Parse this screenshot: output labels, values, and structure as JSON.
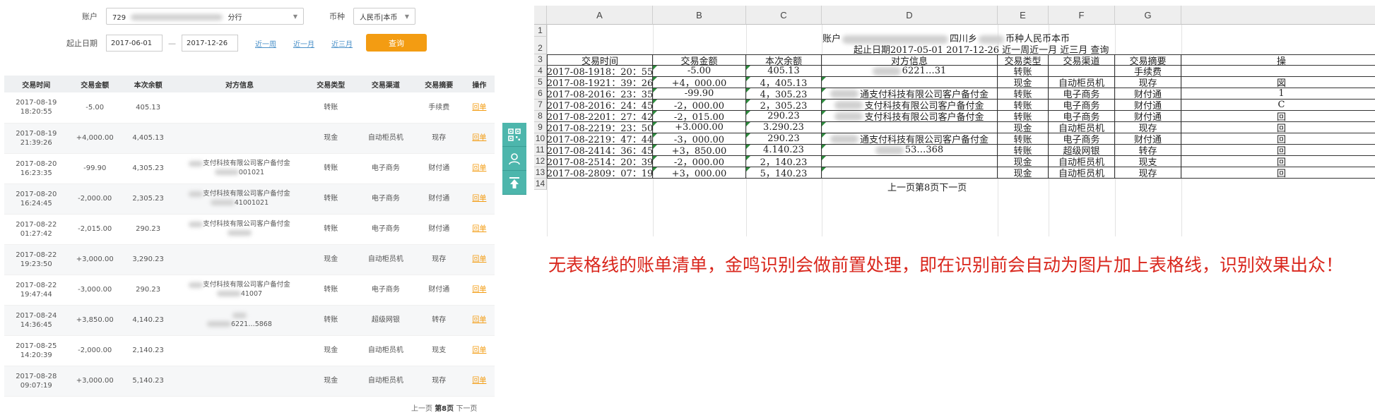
{
  "filters": {
    "account_label": "账户",
    "account_value_prefix": "729",
    "account_value_suffix": "分行",
    "currency_label": "币种",
    "currency_value": "人民币|本币",
    "date_label": "起止日期",
    "date_start": "2017-06-01",
    "date_end": "2017-12-26",
    "quick_links": [
      "近一周",
      "近一月",
      "近三月"
    ],
    "query_button": "查询"
  },
  "table": {
    "headers": [
      "交易时间",
      "交易金额",
      "本次余额",
      "对方信息",
      "交易类型",
      "交易渠道",
      "交易摘要",
      "操作"
    ],
    "rows": [
      {
        "date": "2017-08-19",
        "time": "18:20:55",
        "amount": "-5.00",
        "balance": "405.13",
        "cp1": "",
        "cp2": "",
        "type": "转账",
        "channel": "",
        "summary": "手续费",
        "op": "回单"
      },
      {
        "date": "2017-08-19",
        "time": "21:39:26",
        "amount": "+4,000.00",
        "balance": "4,405.13",
        "cp1": "",
        "cp2": "",
        "type": "现金",
        "channel": "自动柜员机",
        "summary": "现存",
        "op": "回单"
      },
      {
        "date": "2017-08-20",
        "time": "16:23:35",
        "amount": "-99.90",
        "balance": "4,305.23",
        "cp1": "支付科技有限公司客户备付金",
        "cp2": "001021",
        "type": "转账",
        "channel": "电子商务",
        "summary": "财付通",
        "op": "回单"
      },
      {
        "date": "2017-08-20",
        "time": "16:24:45",
        "amount": "-2,000.00",
        "balance": "2,305.23",
        "cp1": "支付科技有限公司客户备付金",
        "cp2": "41001021",
        "type": "转账",
        "channel": "电子商务",
        "summary": "财付通",
        "op": "回单"
      },
      {
        "date": "2017-08-22",
        "time": "01:27:42",
        "amount": "-2,015.00",
        "balance": "290.23",
        "cp1": "支付科技有限公司客户备付金",
        "cp2": "",
        "type": "转账",
        "channel": "电子商务",
        "summary": "财付通",
        "op": "回单"
      },
      {
        "date": "2017-08-22",
        "time": "19:23:50",
        "amount": "+3,000.00",
        "balance": "3,290.23",
        "cp1": "",
        "cp2": "",
        "type": "现金",
        "channel": "自动柜员机",
        "summary": "现存",
        "op": "回单"
      },
      {
        "date": "2017-08-22",
        "time": "19:47:44",
        "amount": "-3,000.00",
        "balance": "290.23",
        "cp1": "支付科技有限公司客户备付金",
        "cp2": "41007",
        "type": "转账",
        "channel": "电子商务",
        "summary": "财付通",
        "op": "回单"
      },
      {
        "date": "2017-08-24",
        "time": "14:36:45",
        "amount": "+3,850.00",
        "balance": "4,140.23",
        "cp1": "",
        "cp2": "6221…5868",
        "type": "转账",
        "channel": "超级网银",
        "summary": "转存",
        "op": "回单"
      },
      {
        "date": "2017-08-25",
        "time": "14:20:39",
        "amount": "-2,000.00",
        "balance": "2,140.23",
        "cp1": "",
        "cp2": "",
        "type": "现金",
        "channel": "自动柜员机",
        "summary": "现支",
        "op": "回单"
      },
      {
        "date": "2017-08-28",
        "time": "09:07:19",
        "amount": "+3,000.00",
        "balance": "5,140.23",
        "cp1": "",
        "cp2": "",
        "type": "现金",
        "channel": "自动柜员机",
        "summary": "现存",
        "op": "回单"
      }
    ]
  },
  "pager": {
    "prev": "上一页",
    "current": "第8页",
    "next": "下一页"
  },
  "tools": [
    {
      "icon": "qrcode-icon"
    },
    {
      "icon": "customer-service-icon"
    },
    {
      "icon": "back-to-top-icon"
    }
  ],
  "sheet": {
    "columns": [
      "A",
      "B",
      "C",
      "D",
      "E",
      "F",
      "G"
    ],
    "row_numbers": [
      "1",
      "2",
      "3",
      "4",
      "5",
      "6",
      "7",
      "8",
      "9",
      "10",
      "11",
      "12",
      "13",
      "14"
    ],
    "title_left": "账户",
    "title_mid": "四川乡",
    "title_right": "币种人民币本币",
    "subtitle": "起止日期2017-05-01 2017-12-26 近一周近一月 近三月 查询",
    "header": [
      "交易时间",
      "交易金额",
      "本次余额",
      "对方信息",
      "交易类型",
      "交易渠道",
      "交易摘要",
      "操"
    ],
    "rows": [
      {
        "time": "2017-08-1918：20：55",
        "amount": "-5.00",
        "balance": "405.13",
        "cp": "6221…31",
        "type": "转账",
        "channel": "",
        "summary": "手续费",
        "op": ""
      },
      {
        "time": "2017-08-1921：39：26",
        "amount": "+4，000.00",
        "balance": "4，405.13",
        "cp": "",
        "type": "现金",
        "channel": "自动柜员机",
        "summary": "现存",
        "op": "図"
      },
      {
        "time": "2017-08-2016：23：35",
        "amount": "-99.90",
        "balance": "4，305.23",
        "cp": "通支付科技有限公司客户备付金",
        "type": "转账",
        "channel": "电子商务",
        "summary": "财付通",
        "op": "1"
      },
      {
        "time": "2017-08-2016：24：45",
        "amount": "-2，000.00",
        "balance": "2，305.23",
        "cp": "支付科技有限公司客户备付金",
        "type": "转账",
        "channel": "电子商务",
        "summary": "财付通",
        "op": "C"
      },
      {
        "time": "2017-08-2201：27：42",
        "amount": "-2，015.00",
        "balance": "290.23",
        "cp": "支付科技有限公司客户备付金",
        "type": "转账",
        "channel": "电子商务",
        "summary": "财付通",
        "op": "回"
      },
      {
        "time": "2017-08-2219：23：50",
        "amount": "+3.000.00",
        "balance": "3.290.23",
        "cp": "",
        "type": "现金",
        "channel": "自动柜员机",
        "summary": "现存",
        "op": "回"
      },
      {
        "time": "2017-08-2219：47：44",
        "amount": "-3，000.00",
        "balance": "290.23",
        "cp": "通支付科技有限公司客户备付金",
        "type": "转账",
        "channel": "电子商务",
        "summary": "财付通",
        "op": "回"
      },
      {
        "time": "2017-08-2414：36：45",
        "amount": "+3，850.00",
        "balance": "4.140.23",
        "cp": "53…368",
        "type": "转账",
        "channel": "超级网银",
        "summary": "转存",
        "op": "回"
      },
      {
        "time": "2017-08-2514：20：39",
        "amount": "-2，000.00",
        "balance": "2，140.23",
        "cp": "",
        "type": "现金",
        "channel": "自动柜员机",
        "summary": "现支",
        "op": "回"
      },
      {
        "time": "2017-08-2809：07：19",
        "amount": "+3，000.00",
        "balance": "5，140.23",
        "cp": "",
        "type": "现金",
        "channel": "自动柜员机",
        "summary": "现存",
        "op": "回"
      }
    ],
    "footer": "上一页第8页下一页"
  },
  "caption": "无表格线的账单清单，金鸣识别会做前置处理，即在识别前会自动为图片加上表格线，识别效果出众！",
  "colors": {
    "accent": "#f39c12",
    "tool_teal": "#4db6ac",
    "link_blue": "#4a90c8",
    "caption_red": "#d9261c",
    "sheet_marker": "#2e8b3e"
  }
}
